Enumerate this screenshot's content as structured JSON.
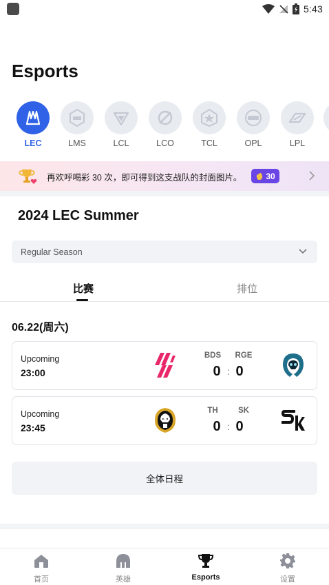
{
  "status_bar": {
    "time": "5:43"
  },
  "header": {
    "title": "Esports"
  },
  "leagues": [
    {
      "label": "LEC",
      "icon": "lec-logo-icon",
      "active": true
    },
    {
      "label": "LMS",
      "icon": "lms-logo-icon",
      "active": false
    },
    {
      "label": "LCL",
      "icon": "lcl-logo-icon",
      "active": false
    },
    {
      "label": "LCO",
      "icon": "lco-logo-icon",
      "active": false
    },
    {
      "label": "TCL",
      "icon": "tcl-logo-icon",
      "active": false
    },
    {
      "label": "OPL",
      "icon": "opl-logo-icon",
      "active": false
    },
    {
      "label": "LPL",
      "icon": "lpl-logo-icon",
      "active": false
    }
  ],
  "banner": {
    "text": "再欢呼喝彩 30 次，即可得到这支战队的封面图片。",
    "badge_count": "30"
  },
  "season": {
    "title": "2024 LEC Summer",
    "stage_select": "Regular Season"
  },
  "tabs": {
    "matches": "比赛",
    "standings": "排位"
  },
  "schedule": {
    "date": "06.22(周六)",
    "matches": [
      {
        "status": "Upcoming",
        "time": "23:00",
        "home_code": "BDS",
        "away_code": "RGE",
        "home_score": "0",
        "away_score": "0",
        "separator": ":"
      },
      {
        "status": "Upcoming",
        "time": "23:45",
        "home_code": "TH",
        "away_code": "SK",
        "home_score": "0",
        "away_score": "0",
        "separator": ":"
      }
    ],
    "full_schedule_label": "全体日程"
  },
  "bottom_nav": {
    "items": [
      {
        "label": "首页",
        "icon": "home-icon",
        "active": false
      },
      {
        "label": "英雄",
        "icon": "champion-helmet-icon",
        "active": false
      },
      {
        "label": "Esports",
        "icon": "trophy-icon",
        "active": true
      },
      {
        "label": "设置",
        "icon": "gear-icon",
        "active": false
      }
    ]
  },
  "colors": {
    "accent": "#2f62e6",
    "badge": "#6a45e5",
    "bds_logo": "#e8286b",
    "rge_logo": "#1f6f8b"
  }
}
